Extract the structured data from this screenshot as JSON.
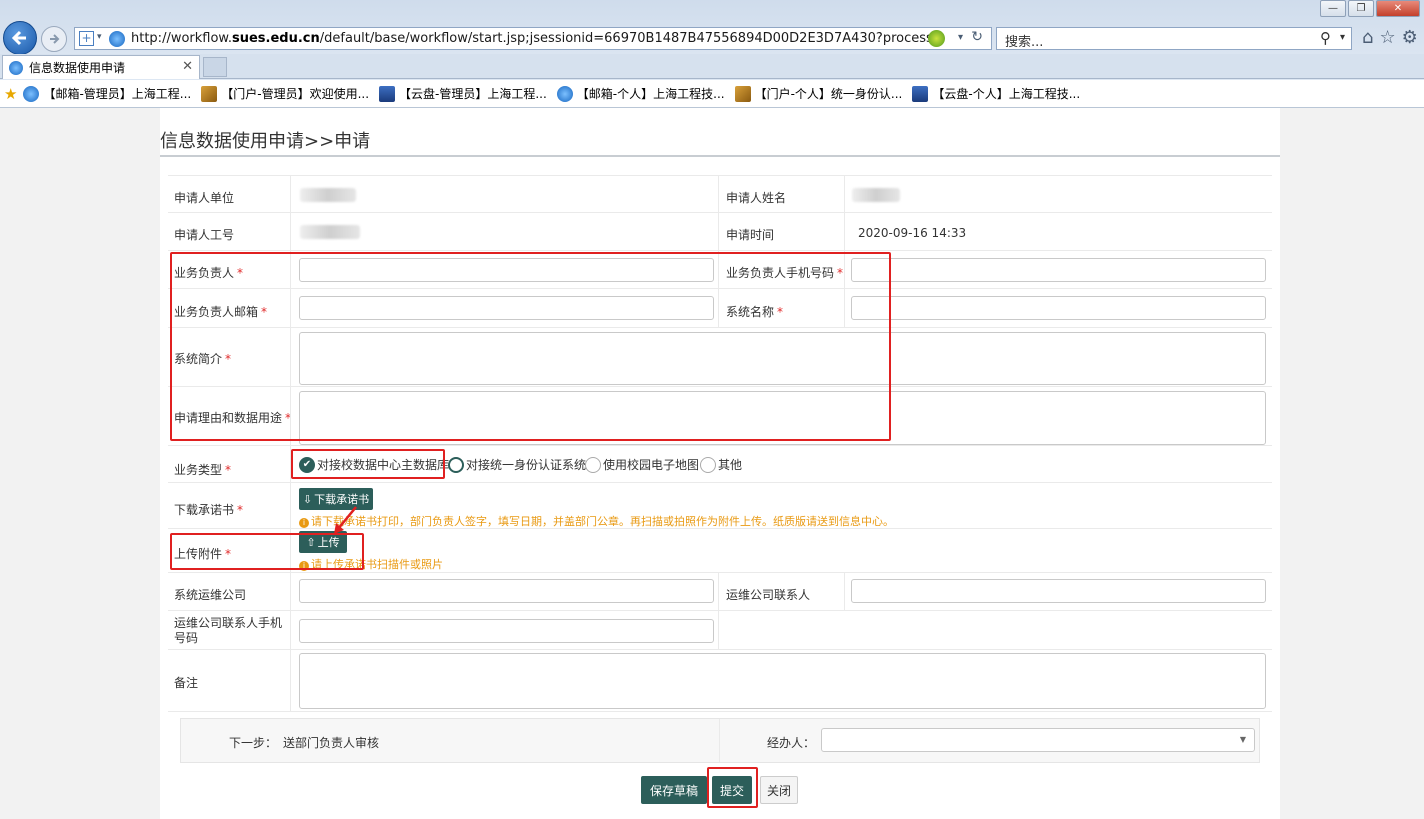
{
  "browser": {
    "url_prefix": "http://workflow.",
    "url_domain": "sues.edu.cn",
    "url_rest": "/default/base/workflow/start.jsp;jsessionid=66970B1487B47556894D00D2E3D7A430?process=com.sudytech.v",
    "search_placeholder": "搜索...",
    "tab_title": "信息数据使用申请",
    "favorites": [
      {
        "label": "【邮箱-管理员】上海工程...",
        "icon": "ie-icon"
      },
      {
        "label": "【门户-管理员】欢迎使用...",
        "icon": "portal-icon"
      },
      {
        "label": "【云盘-管理员】上海工程...",
        "icon": "cloud-icon"
      },
      {
        "label": "【邮箱-个人】上海工程技...",
        "icon": "ie-icon"
      },
      {
        "label": "【门户-个人】统一身份认...",
        "icon": "portal-icon"
      },
      {
        "label": "【云盘-个人】上海工程技...",
        "icon": "cloud-icon"
      }
    ]
  },
  "page": {
    "title": "信息数据使用申请>>申请"
  },
  "form": {
    "applicant_unit_label": "申请人单位",
    "applicant_name_label": "申请人姓名",
    "applicant_id_label": "申请人工号",
    "apply_time_label": "申请时间",
    "apply_time_value": "2020-09-16 14:33",
    "biz_owner_label": "业务负责人",
    "biz_owner_phone_label": "业务负责人手机号码",
    "biz_owner_email_label": "业务负责人邮箱",
    "system_name_label": "系统名称",
    "system_intro_label": "系统简介",
    "reason_label": "申请理由和数据用途",
    "biz_type_label": "业务类型",
    "biz_type_options": [
      "对接校数据中心主数据库",
      "对接统一身份认证系统",
      "使用校园电子地图",
      "其他"
    ],
    "commitment_label": "下载承诺书",
    "download_btn": "下载承诺书",
    "download_hint": "请下载承诺书打印，部门负责人签字，填写日期，并盖部门公章。再扫描或拍照作为附件上传。纸质版请送到信息中心。",
    "attachment_label": "上传附件",
    "upload_btn": "上传",
    "upload_hint": "请上传承诺书扫描件或照片",
    "ops_company_label": "系统运维公司",
    "ops_contact_label": "运维公司联系人",
    "ops_phone_label": "运维公司联系人手机号码",
    "remark_label": "备注",
    "required_mark": "*"
  },
  "next_step": {
    "label": "下一步：",
    "value": "送部门负责人审核",
    "handler_label": "经办人："
  },
  "actions": {
    "save_draft": "保存草稿",
    "submit": "提交",
    "close": "关闭"
  },
  "colors": {
    "primary": "#2c5e5a",
    "hint": "#e99a13",
    "required": "#e12a2a",
    "annotation": "#e02020"
  }
}
